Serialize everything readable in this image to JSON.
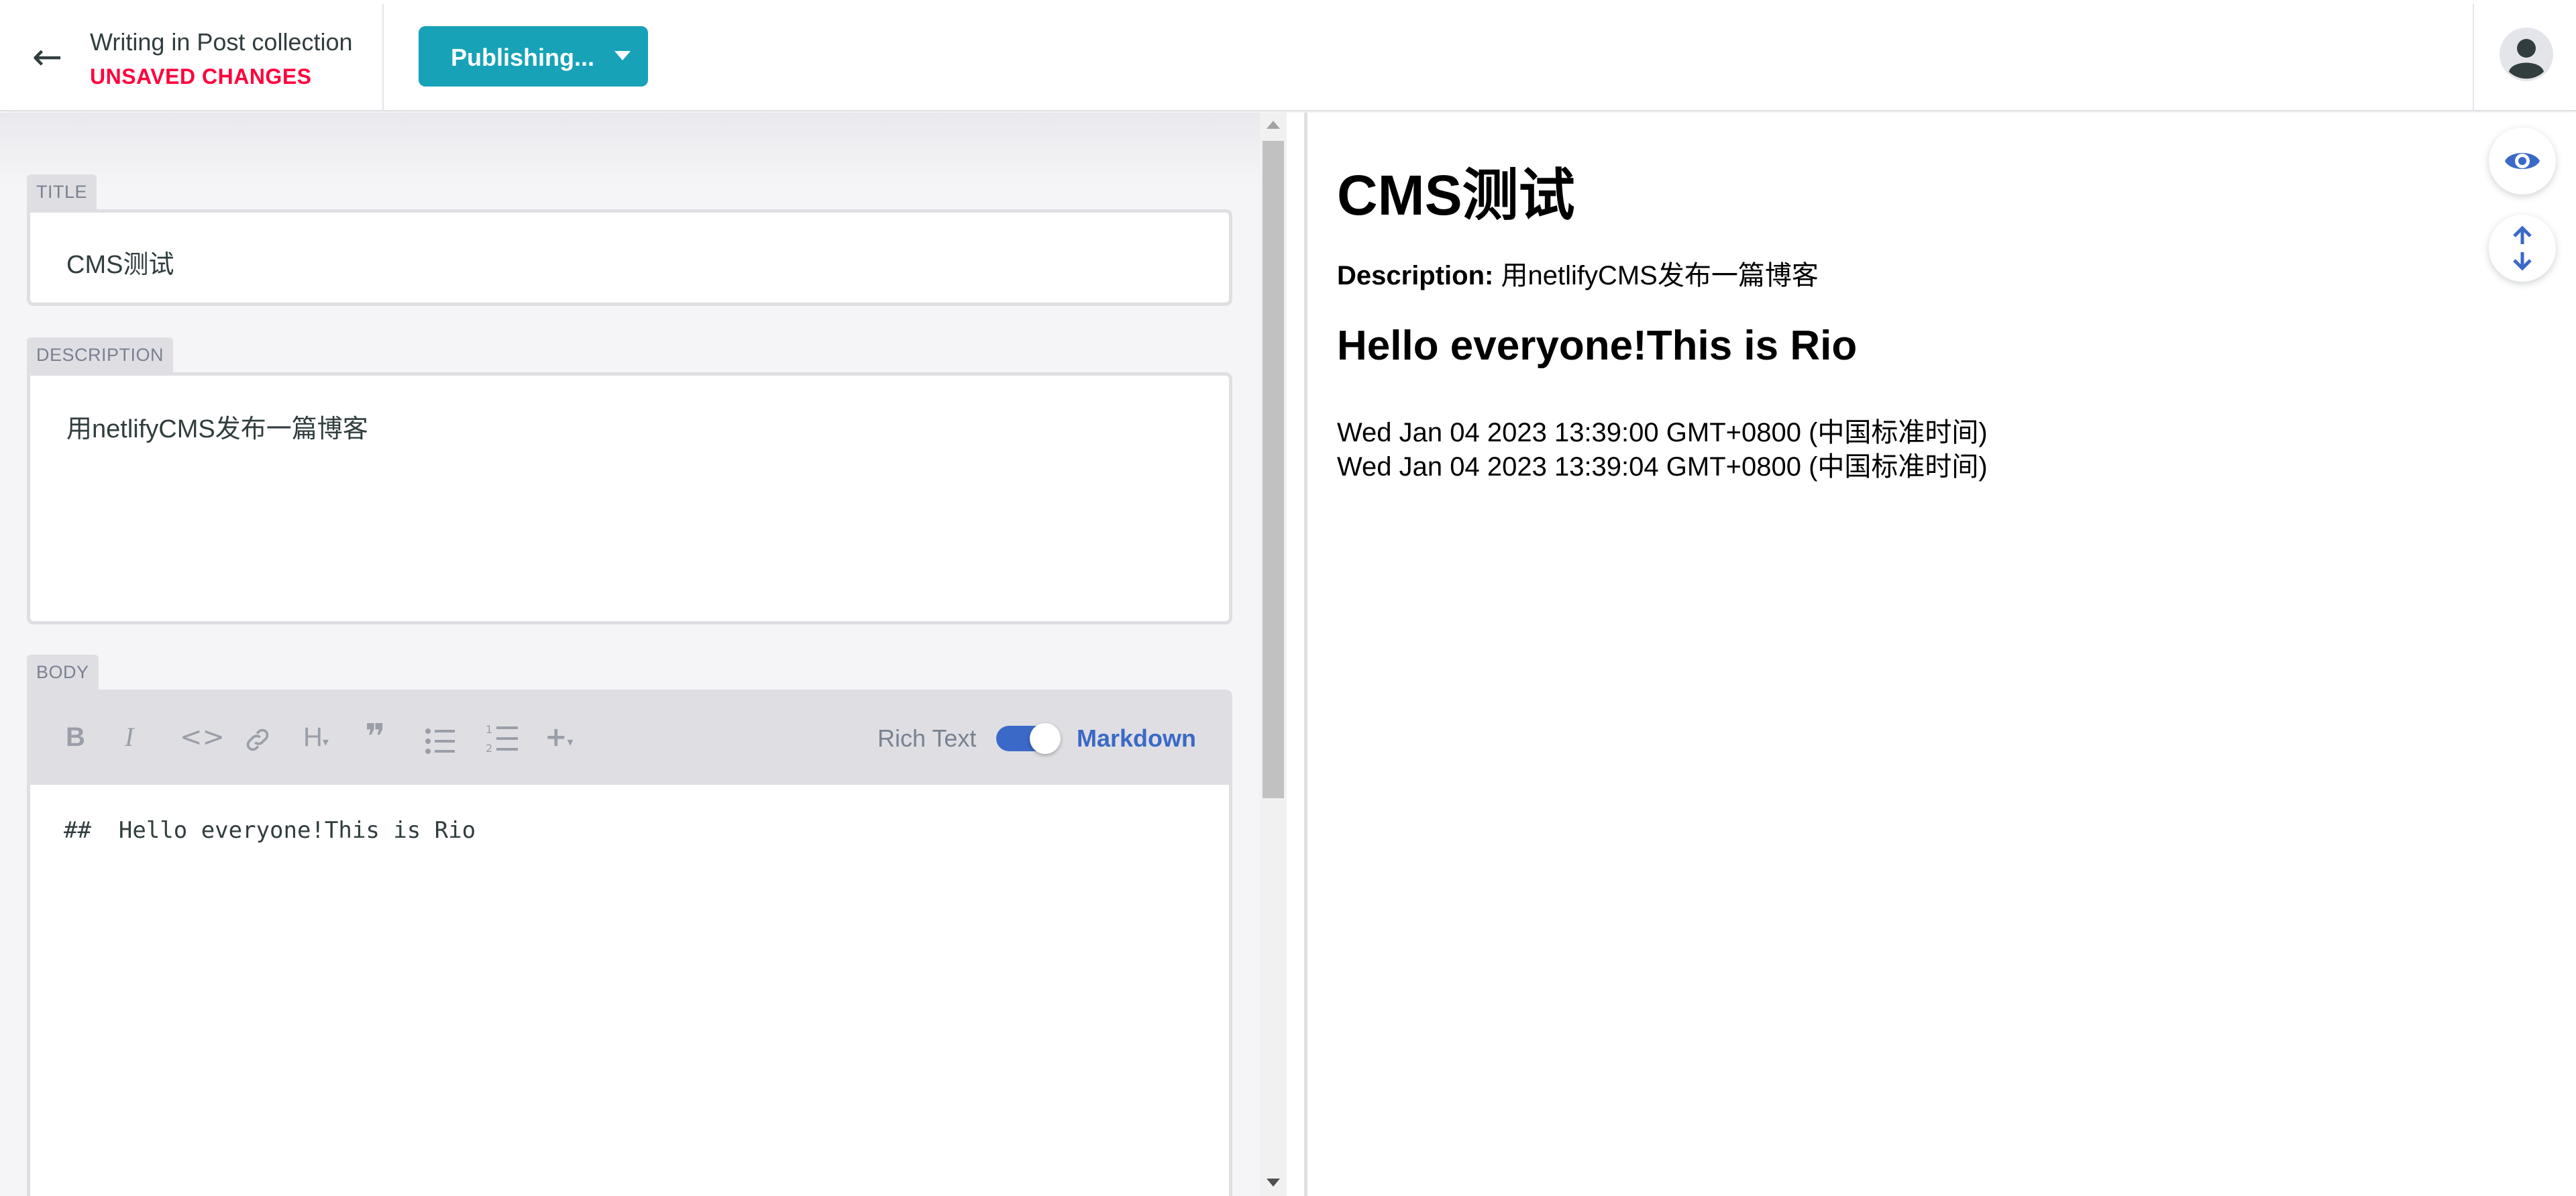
{
  "progress": {
    "fraction": 0.336
  },
  "header": {
    "back_icon": "arrow-left-icon",
    "title": "Writing in Post collection",
    "status": "UNSAVED CHANGES",
    "publish_label": "Publishing...",
    "avatar_icon": "user-avatar-icon"
  },
  "fields": {
    "title_label": "TITLE",
    "title_value": "CMS测试",
    "description_label": "DESCRIPTION",
    "description_value": "用netlifyCMS发布一篇博客",
    "body_label": "BODY"
  },
  "toolbar": {
    "buttons": [
      "bold-icon",
      "italic-icon",
      "code-icon",
      "link-icon",
      "heading-icon",
      "quote-icon",
      "bulleted-list-icon",
      "numbered-list-icon",
      "add-component-icon"
    ],
    "rich_text_label": "Rich Text",
    "markdown_label": "Markdown",
    "markdown_mode": true
  },
  "editor": {
    "content": "##  Hello everyone!This is Rio"
  },
  "preview": {
    "title": "CMS测试",
    "description_label": "Description:",
    "description_value": "用netlifyCMS发布一篇博客",
    "heading": "Hello everyone!This is Rio",
    "date1": "Wed Jan 04 2023 13:39:00 GMT+0800 (中国标准时间)",
    "date2": "Wed Jan 04 2023 13:39:04 GMT+0800 (中国标准时间)",
    "toggle_preview_icon": "eye-icon",
    "sync_scroll_icon": "sync-scroll-icon"
  },
  "colors": {
    "accent": "#3a69c7",
    "publish": "#17a2b8",
    "unsaved": "#ff003b"
  }
}
